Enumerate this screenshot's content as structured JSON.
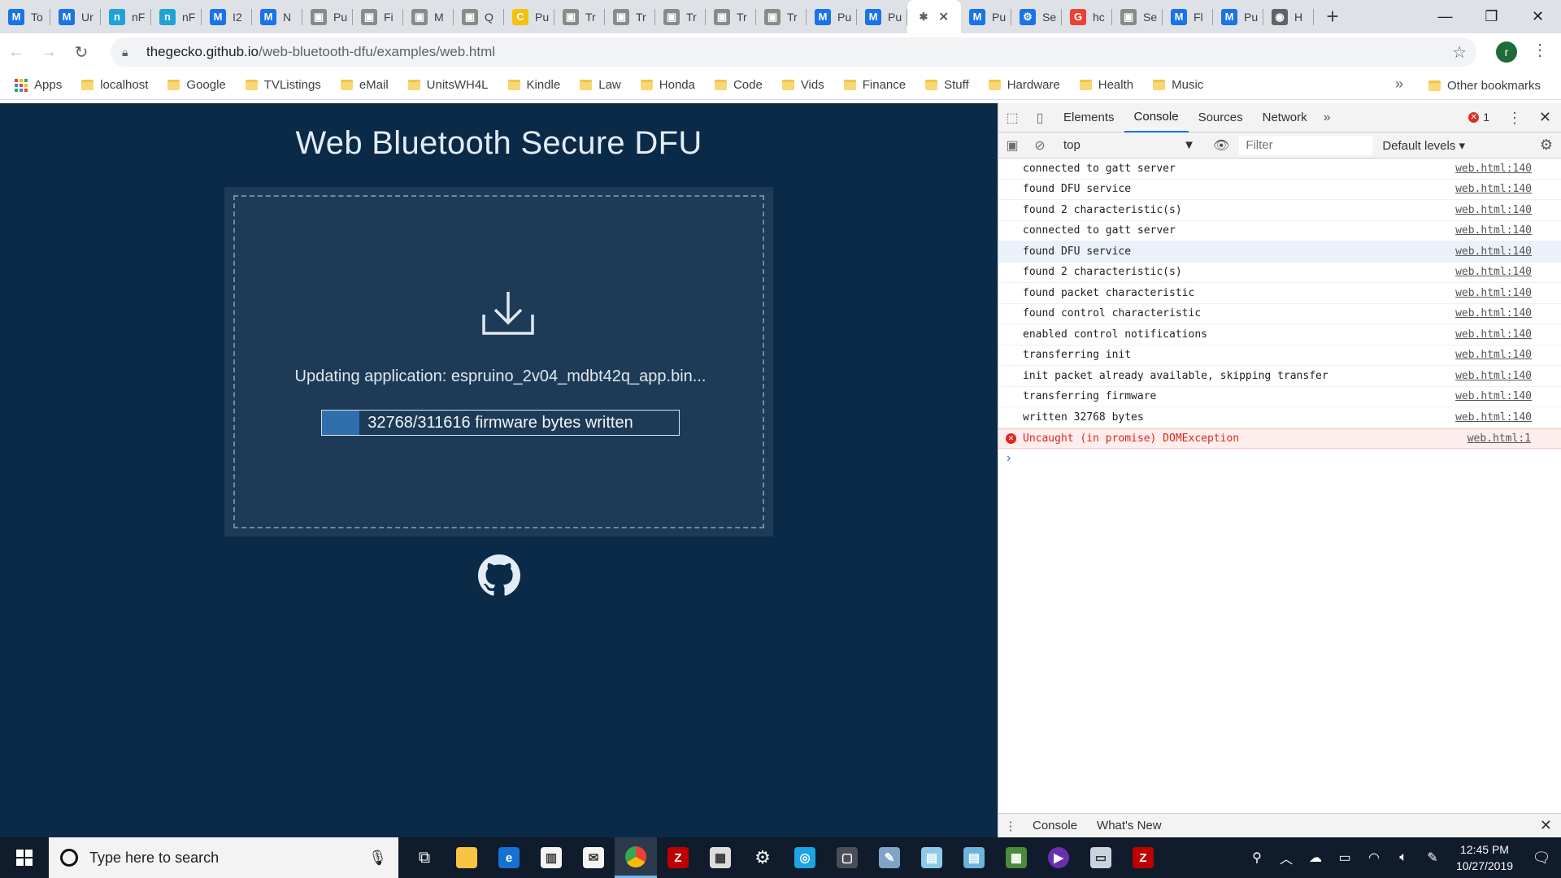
{
  "tabs": [
    {
      "title": "To",
      "icon": "M",
      "color": "#1a73e8"
    },
    {
      "title": "Ur",
      "icon": "M",
      "color": "#1a73e8"
    },
    {
      "title": "nF",
      "icon": "n",
      "color": "#1fa2d6"
    },
    {
      "title": "nF",
      "icon": "n",
      "color": "#1fa2d6"
    },
    {
      "title": "I2",
      "icon": "M",
      "color": "#1a73e8"
    },
    {
      "title": "N",
      "icon": "M",
      "color": "#1a73e8"
    },
    {
      "title": "Pu",
      "icon": "▣",
      "color": "#8a8a8a"
    },
    {
      "title": "Fi",
      "icon": "▣",
      "color": "#8a8a8a"
    },
    {
      "title": "M",
      "icon": "▣",
      "color": "#8a8a8a"
    },
    {
      "title": "Q",
      "icon": "▣",
      "color": "#8a8a8a"
    },
    {
      "title": "Pu",
      "icon": "C",
      "color": "#f4c20d"
    },
    {
      "title": "Tr",
      "icon": "▣",
      "color": "#8a8a8a"
    },
    {
      "title": "Tr",
      "icon": "▣",
      "color": "#8a8a8a"
    },
    {
      "title": "Tr",
      "icon": "▣",
      "color": "#8a8a8a"
    },
    {
      "title": "Tr",
      "icon": "▣",
      "color": "#8a8a8a"
    },
    {
      "title": "Tr",
      "icon": "▣",
      "color": "#8a8a8a"
    },
    {
      "title": "Pu",
      "icon": "M",
      "color": "#1a73e8"
    },
    {
      "title": "Pu",
      "icon": "M",
      "color": "#1a73e8"
    },
    {
      "title": "",
      "icon": "✱",
      "color": "#5f6368",
      "active": true
    },
    {
      "title": "Pu",
      "icon": "M",
      "color": "#1a73e8"
    },
    {
      "title": "Se",
      "icon": "⚙",
      "color": "#1a73e8"
    },
    {
      "title": "hc",
      "icon": "G",
      "color": "#ea4335"
    },
    {
      "title": "Se",
      "icon": "▣",
      "color": "#8a8a8a"
    },
    {
      "title": "Fl",
      "icon": "M",
      "color": "#1a73e8"
    },
    {
      "title": "Pu",
      "icon": "M",
      "color": "#1a73e8"
    },
    {
      "title": "H",
      "icon": "◉",
      "color": "#5f6368"
    }
  ],
  "omnibox": {
    "host": "thegecko.github.io",
    "path": "/web-bluetooth-dfu/examples/web.html",
    "avatar_letter": "r"
  },
  "bookmarks": {
    "items": [
      "Apps",
      "localhost",
      "Google",
      "TVListings",
      "eMail",
      "UnitsWH4L",
      "Kindle",
      "Law",
      "Honda",
      "Code",
      "Vids",
      "Finance",
      "Stuff",
      "Hardware",
      "Health",
      "Music"
    ],
    "more": "»",
    "other": "Other bookmarks"
  },
  "page": {
    "title": "Web Bluetooth Secure DFU",
    "status": "Updating application: espruino_2v04_mdbt42q_app.bin...",
    "progress_text": "32768/311616 firmware bytes written",
    "progress_fraction": 0.105
  },
  "devtools": {
    "tabs": [
      "Elements",
      "Console",
      "Sources",
      "Network"
    ],
    "active_tab": "Console",
    "error_count": "1",
    "context": "top",
    "filter_placeholder": "Filter",
    "levels": "Default levels",
    "logs": [
      {
        "text": "connected to gatt server",
        "src": "web.html:140"
      },
      {
        "text": "found DFU service",
        "src": "web.html:140"
      },
      {
        "text": "found 2 characteristic(s)",
        "src": "web.html:140"
      },
      {
        "text": "connected to gatt server",
        "src": "web.html:140"
      },
      {
        "text": "found DFU service",
        "src": "web.html:140",
        "highlight": true
      },
      {
        "text": "found 2 characteristic(s)",
        "src": "web.html:140"
      },
      {
        "text": "found packet characteristic",
        "src": "web.html:140"
      },
      {
        "text": "found control characteristic",
        "src": "web.html:140"
      },
      {
        "text": "enabled control notifications",
        "src": "web.html:140"
      },
      {
        "text": "transferring init",
        "src": "web.html:140"
      },
      {
        "text": "init packet already available, skipping transfer",
        "src": "web.html:140"
      },
      {
        "text": "transferring firmware",
        "src": "web.html:140"
      },
      {
        "text": "written 32768 bytes",
        "src": "web.html:140"
      }
    ],
    "error_log": {
      "text": "Uncaught (in promise) DOMException",
      "src": "web.html:1"
    },
    "drawer_tabs": [
      "Console",
      "What's New"
    ]
  },
  "taskbar": {
    "search_placeholder": "Type here to search",
    "time": "12:45 PM",
    "date": "10/27/2019"
  }
}
